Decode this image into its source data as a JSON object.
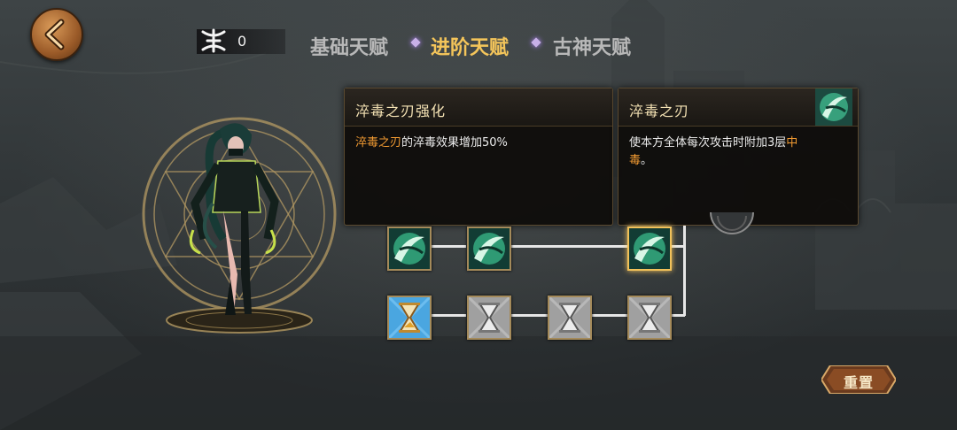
{
  "currency": {
    "icon": "rune-icon",
    "value": "0"
  },
  "tabs": [
    {
      "label": "基础天赋",
      "active": false
    },
    {
      "label": "进阶天赋",
      "active": true
    },
    {
      "label": "古神天赋",
      "active": false
    }
  ],
  "tooltip_left": {
    "title": "淬毒之刃强化",
    "desc_highlight": "淬毒之刃",
    "desc_rest": "的淬毒效果增加50%"
  },
  "tooltip_right": {
    "title": "淬毒之刃",
    "desc_before": "使本方全体每次攻击时附加3层",
    "desc_hl1": "中",
    "desc_hl2": "毒",
    "desc_after": "。",
    "icon": "poison-blade-icon"
  },
  "talent_nodes": {
    "row1": [
      "poison-blade-icon",
      "poison-blade-icon",
      "poison-blade-icon"
    ],
    "row2": [
      "hourglass-icon",
      "hourglass-icon",
      "hourglass-icon",
      "hourglass-icon"
    ]
  },
  "reset_label": "重置",
  "colors": {
    "active_tab": "#f4c55a",
    "highlight": "#f29b32",
    "panel_title": "#f4e2b4"
  }
}
